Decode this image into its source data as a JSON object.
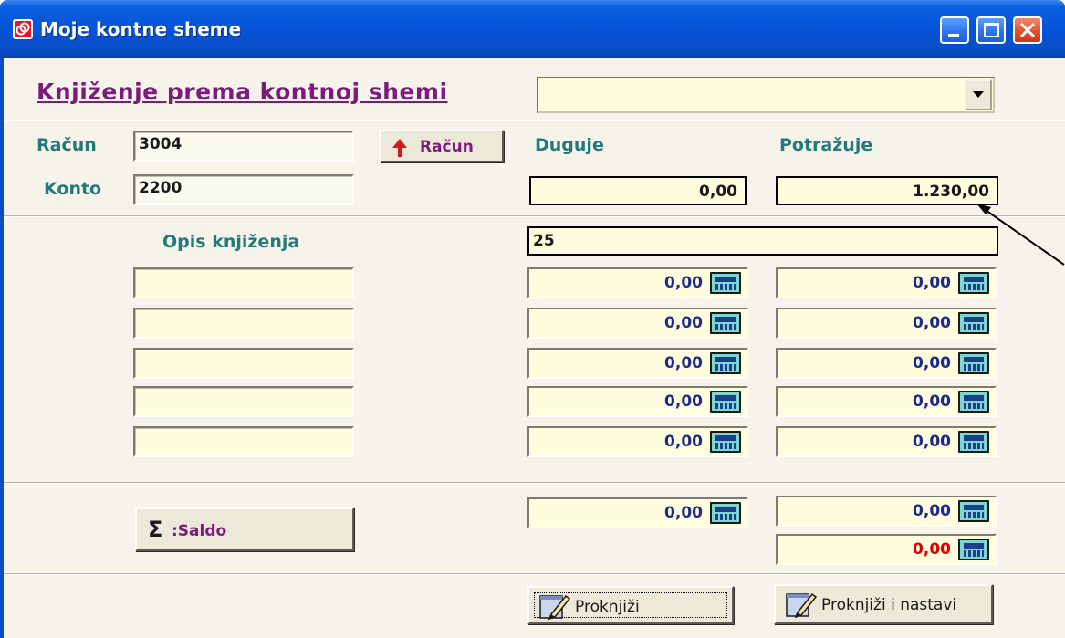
{
  "window": {
    "title": "Moje kontne sheme",
    "accent": "#0554d6",
    "icon": "app-logo-icon"
  },
  "heading": "Knjiženje prema kontnoj shemi",
  "scheme_select": {
    "value": ""
  },
  "labels": {
    "racun": "Račun",
    "konto": "Konto",
    "duguje": "Duguje",
    "potrazuje": "Potražuje",
    "opis": "Opis knjiženja"
  },
  "racun_value": "3004",
  "konto_value": "2200",
  "racun_button": "Račun",
  "main_duguje": "0,00",
  "main_potrazuje": "1.230,00",
  "opis_value": "25",
  "rows": [
    {
      "desc": "",
      "duguje": "0,00",
      "potrazuje": "0,00"
    },
    {
      "desc": "",
      "duguje": "0,00",
      "potrazuje": "0,00"
    },
    {
      "desc": "",
      "duguje": "0,00",
      "potrazuje": "0,00"
    },
    {
      "desc": "",
      "duguje": "0,00",
      "potrazuje": "0,00"
    },
    {
      "desc": "",
      "duguje": "0,00",
      "potrazuje": "0,00"
    }
  ],
  "saldo": {
    "button": ":Saldo",
    "symbol": "Σ",
    "duguje": "0,00",
    "potrazuje": "0,00",
    "difference": "0,00",
    "difference_color": "#e00000"
  },
  "actions": {
    "post": "Proknjiži",
    "post_continue": "Proknjiži i nastavi"
  }
}
